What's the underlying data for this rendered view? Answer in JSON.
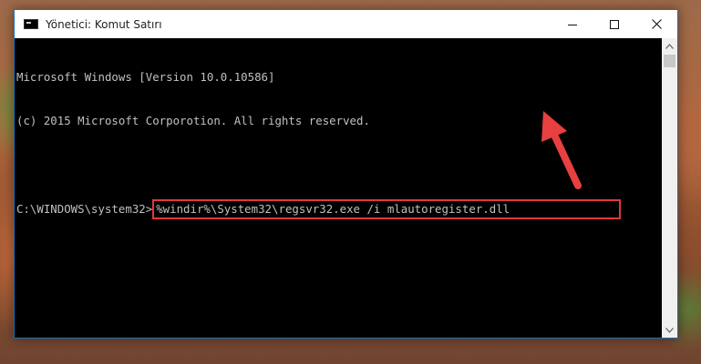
{
  "window": {
    "title": "Yönetici: Komut Satırı",
    "border_color": "#1c6fb8",
    "icon": "cmd-app-icon"
  },
  "title_controls": {
    "minimize_icon": "minimize-icon",
    "maximize_icon": "maximize-icon",
    "close_icon": "close-icon"
  },
  "console": {
    "background_color": "#000000",
    "text_color": "#c0c0c0",
    "lines": [
      "Microsoft Windows [Version 10.0.10586]",
      "(c) 2015 Microsoft Corporotion. All rights reserved.",
      ""
    ],
    "prompt": "C:\\WINDOWS\\system32>",
    "command": "%windir%\\System32\\regsvr32.exe /i mlautoregister.dll"
  },
  "annotation": {
    "highlight_color": "#e0383b",
    "arrow_icon": "red-arrow-icon"
  }
}
